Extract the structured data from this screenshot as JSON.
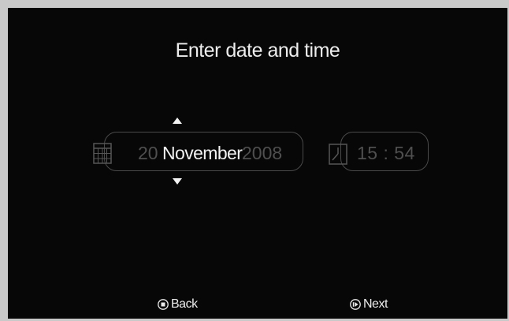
{
  "title": "Enter date and time",
  "date": {
    "day": "20",
    "month": "November",
    "year": "2008"
  },
  "time": {
    "value": "15 : 54"
  },
  "nav": {
    "back_label": "Back",
    "next_label": "Next"
  },
  "icons": {
    "date": "calendar-icon",
    "time": "clock-icon",
    "increment": "up-arrow-icon",
    "decrement": "down-arrow-icon",
    "back": "stop-button-icon",
    "next": "play-button-icon"
  },
  "colors": {
    "background": "#070707",
    "text_active": "#f2f2f2",
    "text_inactive": "#4f4f4f",
    "border": "#4a4a4a"
  }
}
